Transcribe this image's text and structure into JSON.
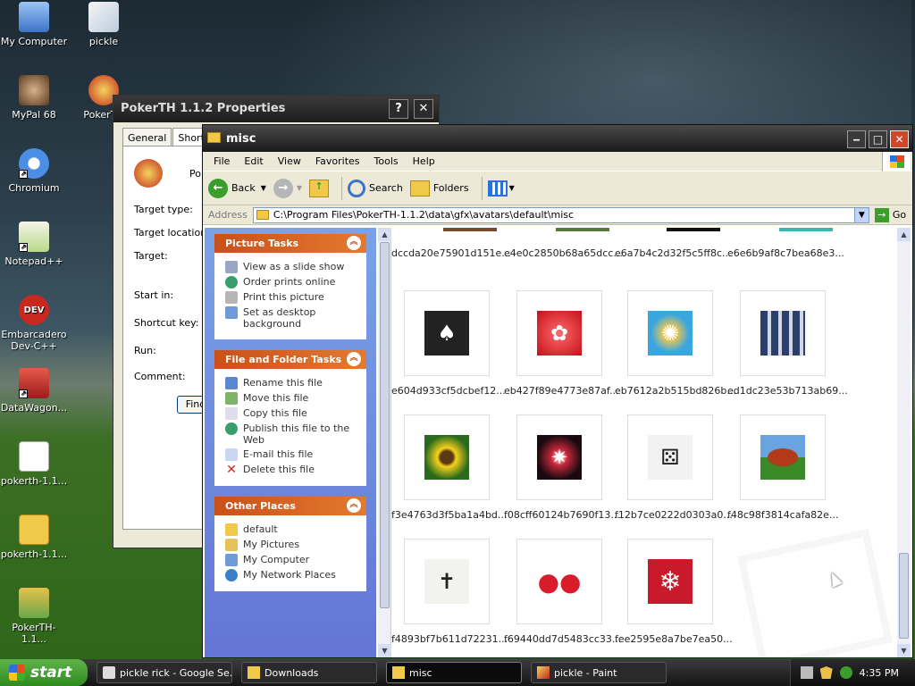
{
  "desktop": {
    "icons": [
      {
        "label": "My Computer",
        "icon": "my-computer-icon"
      },
      {
        "label": "pickle",
        "icon": "paint-file-icon"
      },
      {
        "label": "MyPal 68",
        "icon": "mypal-icon"
      },
      {
        "label": "PokerTH",
        "icon": "pokerth-icon"
      },
      {
        "label": "Chromium",
        "icon": "chromium-icon"
      },
      {
        "label": "Notepad++",
        "icon": "notepadpp-icon"
      },
      {
        "label": "Embarcadero Dev-C++",
        "icon": "devcpp-icon"
      },
      {
        "label": "DataWagon...",
        "icon": "datawagon-icon"
      },
      {
        "label": "pokerth-1.1...",
        "icon": "installer-icon"
      },
      {
        "label": "pokerth-1.1...",
        "icon": "folder-icon"
      },
      {
        "label": "PokerTH-1.1...",
        "icon": "shortcut-icon"
      }
    ]
  },
  "properties": {
    "title": "PokerTH 1.1.2 Properties",
    "help": "?",
    "close": "✕",
    "tabs": [
      "General",
      "Shortcut"
    ],
    "name_prefix": "Po",
    "fields": [
      "Target type:",
      "Target location:",
      "Target:",
      "Start in:",
      "Shortcut key:",
      "Run:",
      "Comment:"
    ],
    "find_button": "Find"
  },
  "explorer": {
    "title": "misc",
    "menu": [
      "File",
      "Edit",
      "View",
      "Favorites",
      "Tools",
      "Help"
    ],
    "toolbar": {
      "back": "Back",
      "search": "Search",
      "folders": "Folders"
    },
    "address_label": "Address",
    "address": "C:\\Program Files\\PokerTH-1.1.2\\data\\gfx\\avatars\\default\\misc",
    "go": "Go",
    "picture_tasks": {
      "title": "Picture Tasks",
      "items": [
        "View as a slide show",
        "Order prints online",
        "Print this picture",
        "Set as desktop background"
      ]
    },
    "file_tasks": {
      "title": "File and Folder Tasks",
      "items": [
        "Rename this file",
        "Move this file",
        "Copy this file",
        "Publish this file to the Web",
        "E-mail this file",
        "Delete this file"
      ]
    },
    "other_places": {
      "title": "Other Places",
      "items": [
        "default",
        "My Pictures",
        "My Computer",
        "My Network Places"
      ]
    },
    "files": [
      {
        "name": "dccda20e75901d151e...",
        "thumb": "partial"
      },
      {
        "name": "e4e0c2850b68a65dcc...",
        "thumb": "partial"
      },
      {
        "name": "e6a7b4c2d32f5c5ff8c...",
        "thumb": "partial"
      },
      {
        "name": "e6e6b9af8c7bea68e3...",
        "thumb": "partial"
      },
      {
        "name": "e604d933cf5dcbef12...",
        "thumb": "cards"
      },
      {
        "name": "eb427f89e4773e87af...",
        "thumb": "red-flower"
      },
      {
        "name": "eb7612a2b515bd826b...",
        "thumb": "ferris-wheel"
      },
      {
        "name": "ed1dc23e53b713ab69...",
        "thumb": "calculator"
      },
      {
        "name": "f3e4763d3f5ba1a4bd...",
        "thumb": "sunflower"
      },
      {
        "name": "f08cff60124b7690f13...",
        "thumb": "fireworks"
      },
      {
        "name": "f12b7ce0222d0303a0...",
        "thumb": "dice"
      },
      {
        "name": "f48c98f3814cafa82e...",
        "thumb": "football"
      },
      {
        "name": "f4893bf7b611d72231...",
        "thumb": "emblem"
      },
      {
        "name": "f69440dd7d5483cc33...",
        "thumb": "strawberries"
      },
      {
        "name": "fee2595e8a7be7ea50...",
        "thumb": "snowflake"
      }
    ]
  },
  "taskbar": {
    "start": "start",
    "tasks": [
      {
        "label": "pickle rick - Google Se...",
        "icon": "browser-icon"
      },
      {
        "label": "Downloads",
        "icon": "folder-icon"
      },
      {
        "label": "misc",
        "icon": "folder-icon",
        "active": true
      },
      {
        "label": "pickle - Paint",
        "icon": "paint-icon"
      }
    ],
    "clock": "4:35 PM"
  }
}
